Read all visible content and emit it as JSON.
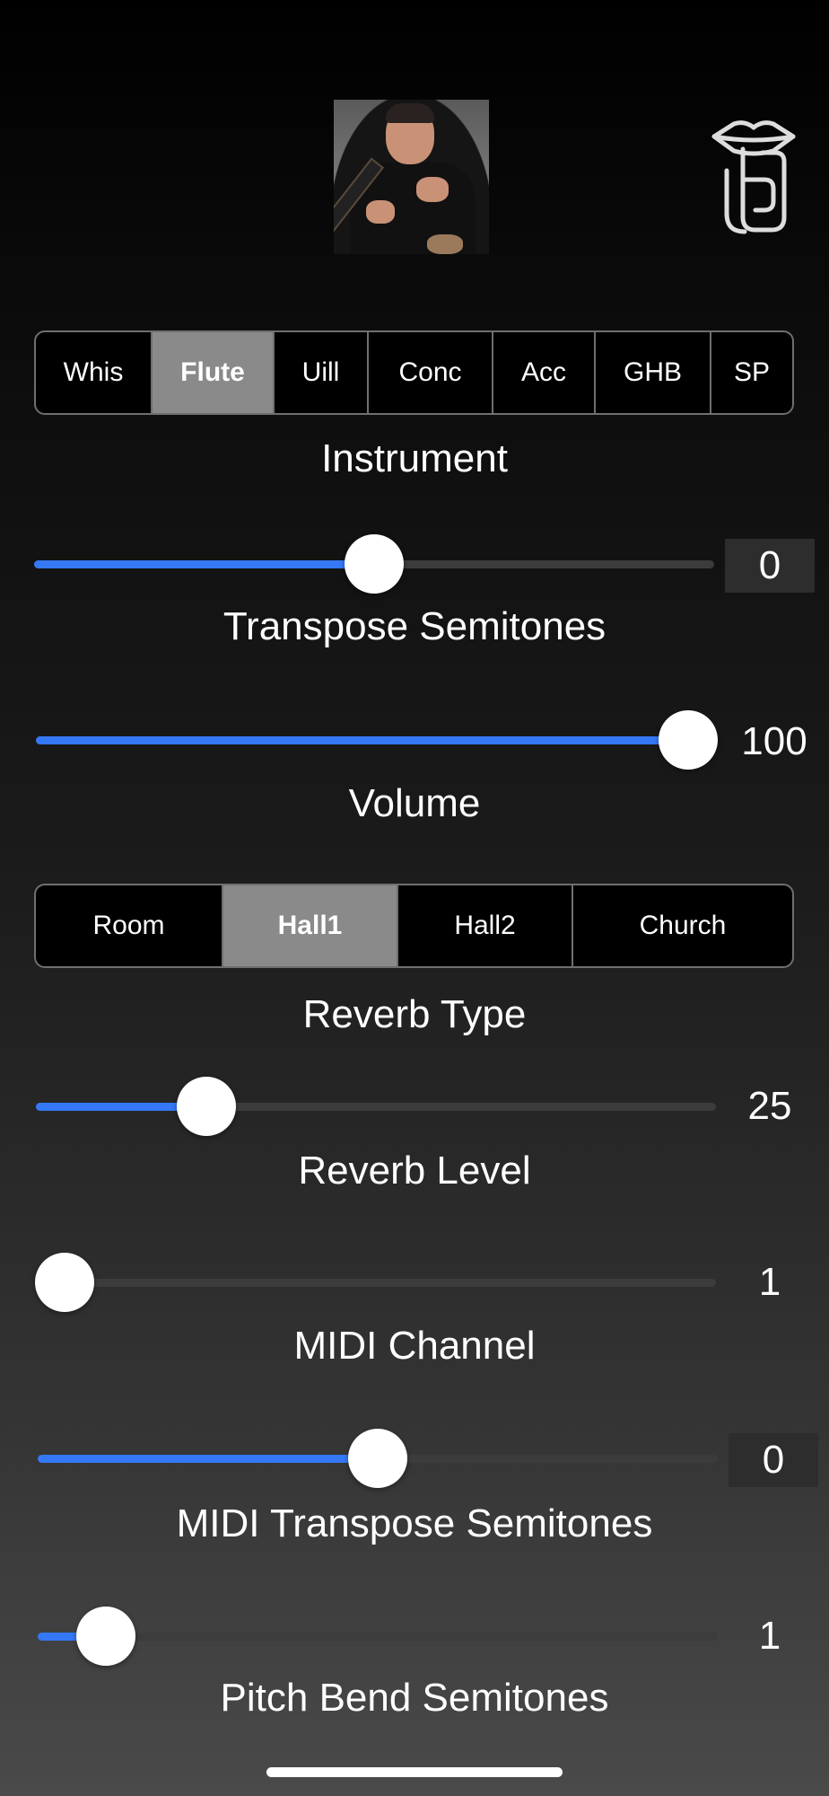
{
  "instrument": {
    "options": [
      "Whis",
      "Flute",
      "Uill",
      "Conc",
      "Acc",
      "GHB",
      "SP"
    ],
    "selected": "Flute",
    "caption": "Instrument"
  },
  "transpose": {
    "value": "0",
    "caption": "Transpose Semitones",
    "fraction": 0.5
  },
  "volume": {
    "value": "100",
    "caption": "Volume",
    "fraction": 1.0
  },
  "reverb_type": {
    "options": [
      "Room",
      "Hall1",
      "Hall2",
      "Church"
    ],
    "selected": "Hall1",
    "caption": "Reverb Type"
  },
  "reverb_level": {
    "value": "25",
    "caption": "Reverb Level",
    "fraction": 0.25
  },
  "midi_channel": {
    "value": "1",
    "caption": "MIDI Channel",
    "fraction": 0.0
  },
  "midi_transpose": {
    "value": "0",
    "caption": "MIDI Transpose Semitones",
    "fraction": 0.5
  },
  "pitch_bend": {
    "value": "1",
    "caption": "Pitch Bend Semitones",
    "fraction": 0.1
  },
  "colors": {
    "accent": "#3478f6",
    "selected_segment": "#8a8a8a",
    "track": "#3c3c3c"
  },
  "icons": {
    "logo": "lips-finger-logo-icon",
    "avatar": "flute-player-photo"
  }
}
